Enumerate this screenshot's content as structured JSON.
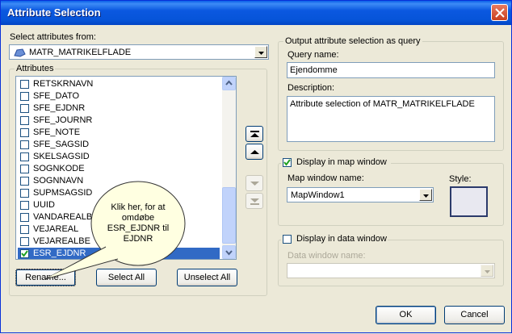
{
  "window": {
    "title": "Attribute Selection"
  },
  "source": {
    "label": "Select attributes from:",
    "value": "MATR_MATRIKELFLADE"
  },
  "attributes": {
    "group_label": "Attributes",
    "items": [
      {
        "label": "RETSKRNAVN",
        "checked": false
      },
      {
        "label": "SFE_DATO",
        "checked": false
      },
      {
        "label": "SFE_EJDNR",
        "checked": false
      },
      {
        "label": "SFE_JOURNR",
        "checked": false
      },
      {
        "label": "SFE_NOTE",
        "checked": false
      },
      {
        "label": "SFE_SAGSID",
        "checked": false
      },
      {
        "label": "SKELSAGSID",
        "checked": false
      },
      {
        "label": "SOGNKODE",
        "checked": false
      },
      {
        "label": "SOGNNAVN",
        "checked": false
      },
      {
        "label": "SUPMSAGSID",
        "checked": false
      },
      {
        "label": "UUID",
        "checked": false
      },
      {
        "label": "VANDAREALB",
        "checked": false
      },
      {
        "label": "VEJAREAL",
        "checked": false
      },
      {
        "label": "VEJAREALBE",
        "checked": false
      },
      {
        "label": "ESR_EJDNR",
        "checked": true,
        "selected": true
      }
    ],
    "rename_label": "Rename...",
    "select_all_label": "Select All",
    "unselect_all_label": "Unselect All"
  },
  "callout": {
    "text": "Klik her, for at omdøbe ESR_EJDNR til EJDNR"
  },
  "output": {
    "group_label": "Output attribute selection as query",
    "query_name_label": "Query name:",
    "query_name_value": "Ejendomme",
    "description_label": "Description:",
    "description_value": "Attribute selection of MATR_MATRIKELFLADE"
  },
  "map_window": {
    "checkbox_label": "Display in map window",
    "checked": true,
    "name_label": "Map window name:",
    "name_value": "MapWindow1",
    "style_label": "Style:"
  },
  "data_window": {
    "checkbox_label": "Display in data window",
    "checked": false,
    "name_label": "Data window name:",
    "name_value": ""
  },
  "footer": {
    "ok_label": "OK",
    "cancel_label": "Cancel"
  },
  "colors": {
    "title_bar": "#0a5fe8",
    "selection": "#316ac5",
    "dialog_bg": "#ece9d8"
  }
}
